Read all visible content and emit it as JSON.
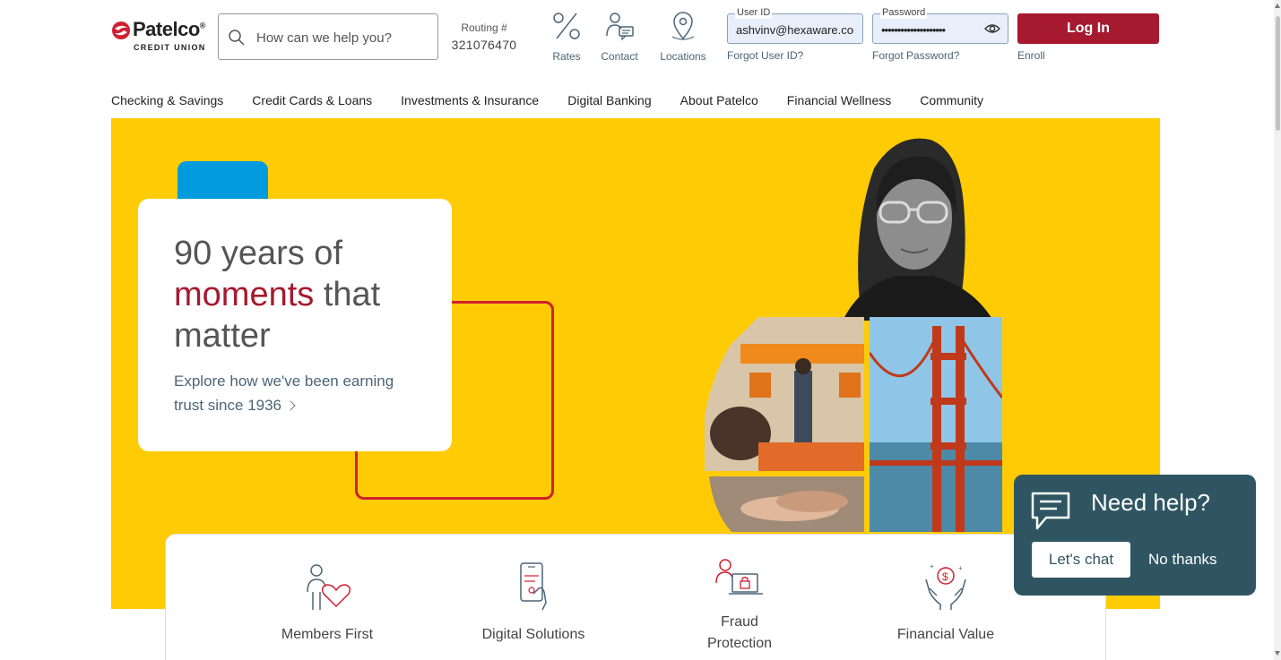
{
  "brand": {
    "name": "Patelco",
    "trademark": "®",
    "subtitle": "CREDIT UNION",
    "primary_color": "#a6192e",
    "hero_color": "#ffcb05",
    "blue_accent": "#009bde",
    "chat_color": "#2f5563"
  },
  "header": {
    "search_placeholder": "How can we help you?",
    "routing_label": "Routing #",
    "routing_number": "321076470",
    "quick_links": [
      {
        "label": "Rates",
        "icon": "percent-icon"
      },
      {
        "label": "Contact",
        "icon": "contact-icon"
      },
      {
        "label": "Locations",
        "icon": "location-pin-icon"
      }
    ],
    "login": {
      "user_id_label": "User ID",
      "user_id_value": "ashvinv@hexaware.com",
      "password_label": "Password",
      "password_value": "••••••••••••••••••••",
      "forgot_user_id": "Forgot User ID?",
      "forgot_password": "Forgot Password?",
      "login_button": "Log In",
      "enroll": "Enroll"
    }
  },
  "nav": {
    "items": [
      "Checking & Savings",
      "Credit Cards & Loans",
      "Investments & Insurance",
      "Digital Banking",
      "About Patelco",
      "Financial Wellness",
      "Community"
    ]
  },
  "hero": {
    "title_part1": "90 years of",
    "title_accent": "moments",
    "title_part2": "that",
    "title_part3": "matter",
    "link_text": "Explore how we've been earning trust since 1936"
  },
  "features": [
    {
      "label": "Members First",
      "icon": "member-heart-icon"
    },
    {
      "label": "Digital Solutions",
      "icon": "phone-hand-icon"
    },
    {
      "label": "Fraud Protection",
      "icon": "laptop-lock-icon"
    },
    {
      "label": "Financial Value",
      "icon": "hands-dollar-icon"
    }
  ],
  "chat": {
    "title": "Need help?",
    "chat_button": "Let's chat",
    "dismiss": "No thanks"
  }
}
